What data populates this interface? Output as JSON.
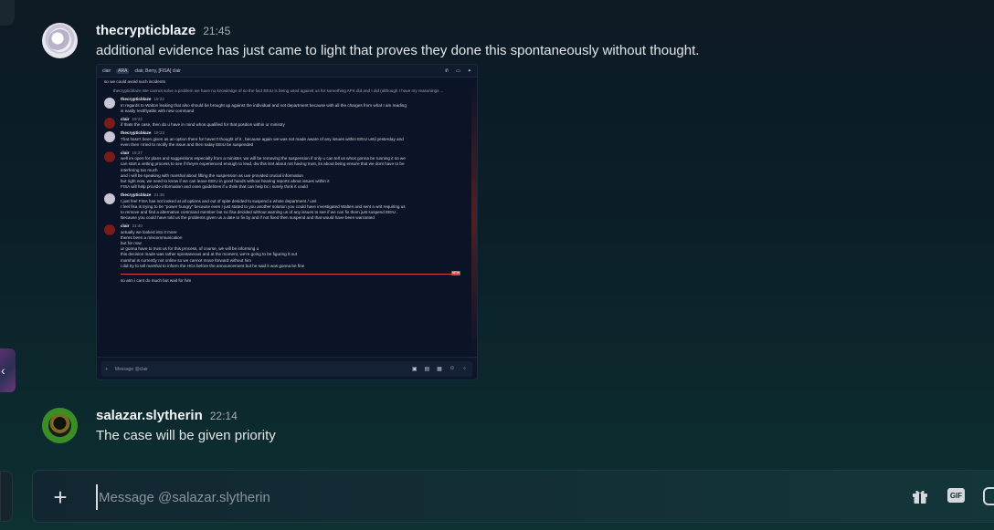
{
  "edge": {
    "chevron": "‹"
  },
  "messages": [
    {
      "username": "thecrypticblaze",
      "timestamp": "21:45",
      "text": "additional evidence has just came to light that proves they done this spontaneously without thought.",
      "attachment": {
        "header": {
          "name": "clair",
          "tag": "ARA",
          "members": "clair, Berry, [FISA] clair"
        },
        "top_line": "so we could avoid such incidents",
        "reply": "thecrypticblaze We cannot solve a problem we have no knowledge of so the fact EEIU is being used against us for something AFK did and I did (although I have my reasonings ...",
        "entries": [
          {
            "name": "thecrypticblaze",
            "time": "19:22",
            "lines": [
              "In regards to Walton leaking that also should be brought up against the individual and not department because with all the charges from what I am reading",
              "is easily rectifiyable with new command"
            ]
          },
          {
            "name": "clair",
            "time": "19:22",
            "lines": [
              "if thats the case, then do u have in mind whos qualified for that position within ur ministry"
            ]
          },
          {
            "name": "thecrypticblaze",
            "time": "19:23",
            "lines": [
              "That hasn't been given as an option there for haven't thought of it , because again we was not made aware of any issues within EEIU until yesterday and",
              "even then I tried to rectify the issue and then today EEIU be suspended"
            ]
          },
          {
            "name": "clair",
            "time": "19:27",
            "lines": [
              "well im open for plans and suggestions especially from a minister, we will be removing the suspension if only u can tell us whos gonna be running it so we",
              "can start a vetting process to see if theyre experienced enough to lead, dw this isnt about not having trust, its about being ensure that we dont have to be",
              "interfering too much",
              "and i will be speaking with marshal about lifting the suspension as uve provided crucial information",
              "but right now, we need to know if we can leave EEIU in good hands without hearing reports about issues within it",
              "FISA will help provide information and even guidelines if u think that can help bc i surely think it could"
            ]
          },
          {
            "name": "thecrypticblaze",
            "time": "21:36",
            "lines": [
              "I just feel FISA has not looked at all options and out of spite desided to suspend a whole department / unit",
              "I feel fisa is trying to be \"power hungry\" because even I just stated to you another solution you could have investigated Walten and sent a writ requiring us",
              "to remove and find a alternative command member but no fisa decided without warning us of any issues to see if we can fix them just suspend EEIU .",
              "Because you could have told us the problems given us a date to fix by and if not fixed then suspend and that would have been warranted"
            ]
          },
          {
            "name": "clair",
            "time": "21:40",
            "lines": [
              "actually we looked into it more",
              "theres been a miscommunication",
              "but for now",
              "ur gonna have to trust us for this process, of course, we will be informing u",
              "this decision made was rather spontaneous and at the moment, we're going to be figuring it out",
              "marshal is currently not online so we cannot move forward without him",
              "i did try to tell marshal to inform the HCs before the announcement but he said it was gonna be fine"
            ]
          }
        ],
        "new_badge": "NEW",
        "last_line": "so atm i cant do much but wait for him",
        "input_placeholder": "Message @clair"
      }
    },
    {
      "username": "salazar.slytherin",
      "timestamp": "22:14",
      "text": "The case will be given priority"
    }
  ],
  "composer": {
    "add_icon": "+",
    "placeholder": "Message @salazar.slytherin",
    "gif_label": "GIF"
  }
}
